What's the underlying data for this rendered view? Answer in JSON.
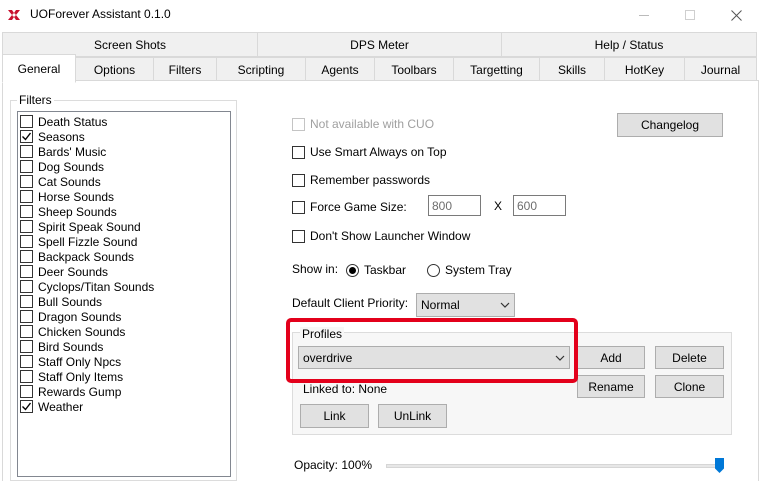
{
  "window": {
    "title": "UOForever Assistant 0.1.0",
    "icons": {
      "app": "uo-app-icon",
      "minimize": "minimize-icon",
      "maximize": "maximize-icon",
      "close": "close-icon"
    }
  },
  "tabs": {
    "row1": [
      "Screen Shots",
      "DPS Meter",
      "Help / Status"
    ],
    "row2": [
      "General",
      "Options",
      "Filters",
      "Scripting",
      "Agents",
      "Toolbars",
      "Targetting",
      "Skills",
      "HotKey",
      "Journal"
    ],
    "active": "General"
  },
  "filters": {
    "title": "Filters",
    "items": [
      {
        "label": "Death Status",
        "checked": false
      },
      {
        "label": "Seasons",
        "checked": true
      },
      {
        "label": "Bards' Music",
        "checked": false
      },
      {
        "label": "Dog Sounds",
        "checked": false
      },
      {
        "label": "Cat Sounds",
        "checked": false
      },
      {
        "label": "Horse Sounds",
        "checked": false
      },
      {
        "label": "Sheep Sounds",
        "checked": false
      },
      {
        "label": "Spirit Speak Sound",
        "checked": false
      },
      {
        "label": "Spell Fizzle Sound",
        "checked": false
      },
      {
        "label": "Backpack Sounds",
        "checked": false
      },
      {
        "label": "Deer Sounds",
        "checked": false
      },
      {
        "label": "Cyclops/Titan Sounds",
        "checked": false
      },
      {
        "label": "Bull Sounds",
        "checked": false
      },
      {
        "label": "Dragon Sounds",
        "checked": false
      },
      {
        "label": "Chicken Sounds",
        "checked": false
      },
      {
        "label": "Bird Sounds",
        "checked": false
      },
      {
        "label": "Staff Only Npcs",
        "checked": false
      },
      {
        "label": "Staff Only Items",
        "checked": false
      },
      {
        "label": "Rewards Gump",
        "checked": false
      },
      {
        "label": "Weather",
        "checked": true
      }
    ]
  },
  "general": {
    "not_available_cuo": "Not available with CUO",
    "changelog_button": "Changelog",
    "smart_always_on_top": "Use Smart Always on Top",
    "remember_passwords": "Remember passwords",
    "force_game_size": "Force Game Size:",
    "game_width": "800",
    "game_height": "600",
    "size_separator": "X",
    "dont_show_launcher": "Don't Show Launcher Window",
    "show_in_label": "Show in:",
    "show_in_taskbar": "Taskbar",
    "show_in_tray": "System Tray",
    "show_in_selected": "Taskbar",
    "client_priority_label": "Default Client Priority:",
    "client_priority_value": "Normal",
    "opacity_label": "Opacity: 100%",
    "opacity_value": 1.0
  },
  "profiles": {
    "title": "Profiles",
    "selected": "overdrive",
    "add_button": "Add",
    "delete_button": "Delete",
    "rename_button": "Rename",
    "clone_button": "Clone",
    "linked_to": "Linked to: None",
    "link_button": "Link",
    "unlink_button": "UnLink"
  },
  "colors": {
    "highlight": "#e3001b",
    "accent": "#0078d7"
  }
}
